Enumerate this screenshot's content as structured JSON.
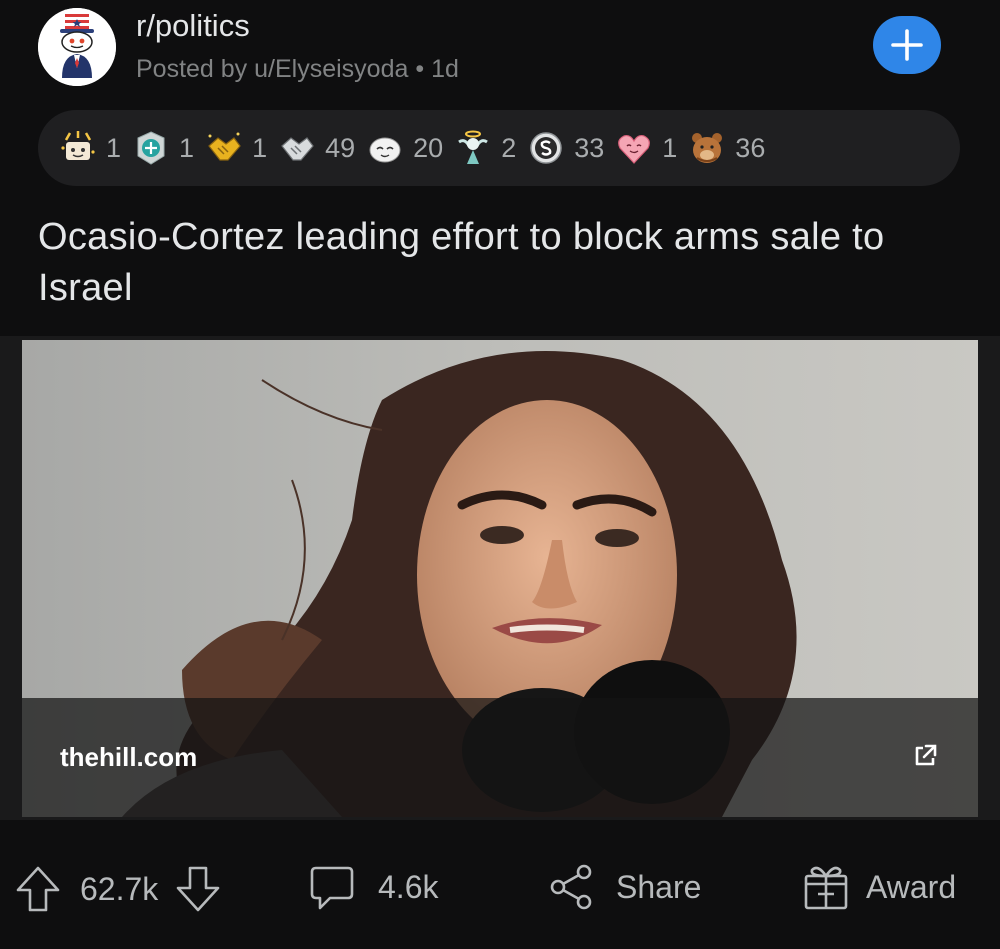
{
  "post": {
    "subreddit": "r/politics",
    "posted_by": "Posted by u/Elyseisyoda",
    "separator": "•",
    "age": "1d",
    "title": "Ocasio-Cortez leading effort to block arms sale to Israel",
    "link_domain": "thehill.com"
  },
  "awards": [
    {
      "icon": "party-award-icon",
      "count": "1"
    },
    {
      "icon": "shield-award-icon",
      "count": "1"
    },
    {
      "icon": "gold-handshake-icon",
      "count": "1"
    },
    {
      "icon": "silver-handshake-icon",
      "count": "49"
    },
    {
      "icon": "wholesome-seal-icon",
      "count": "20"
    },
    {
      "icon": "angel-award-icon",
      "count": "2"
    },
    {
      "icon": "silver-coin-icon",
      "count": "33"
    },
    {
      "icon": "heart-face-icon",
      "count": "1"
    },
    {
      "icon": "bear-award-icon",
      "count": "36"
    }
  ],
  "actions": {
    "upvotes": "62.7k",
    "comments": "4.6k",
    "share_label": "Share",
    "award_label": "Award"
  },
  "colors": {
    "background": "#0e0e0f",
    "accent_blue": "#2f86e8",
    "award_bar": "#1f1f21"
  }
}
